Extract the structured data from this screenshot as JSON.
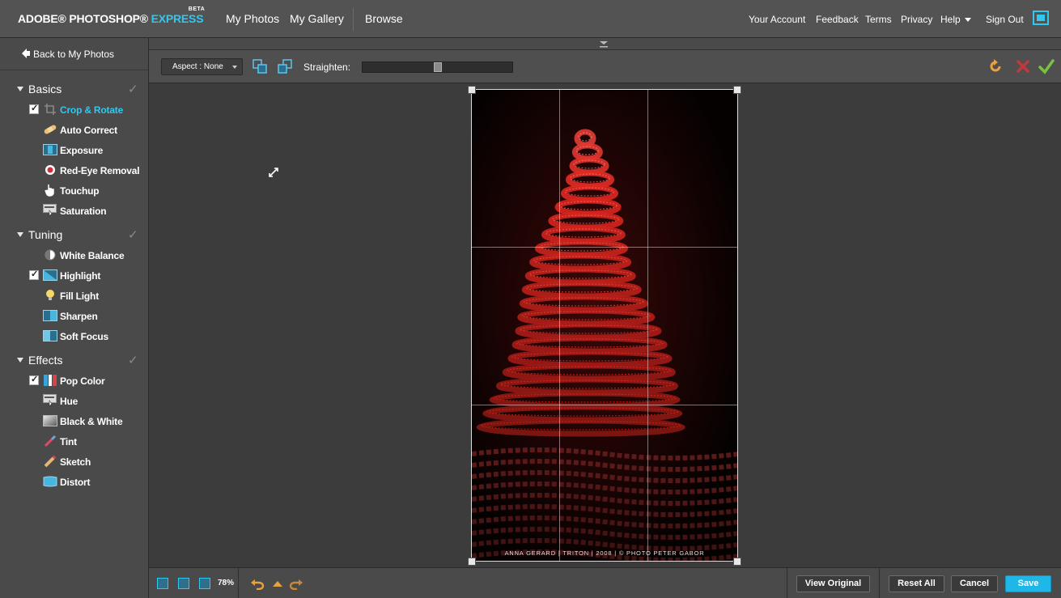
{
  "header": {
    "logo_main": "ADOBE® PHOTOSHOP®",
    "logo_express": "EXPRESS",
    "logo_beta": "BETA",
    "nav": [
      "My Photos",
      "My Gallery",
      "Browse"
    ],
    "right_nav": [
      "Your Account",
      "Feedback",
      "Terms",
      "Privacy",
      "Help",
      "Sign Out"
    ],
    "fullscreen_icon": "fullscreen-icon"
  },
  "sidebar": {
    "back_label": "Back to My Photos",
    "sections": [
      {
        "name": "Basics",
        "items": [
          {
            "label": "Crop & Rotate",
            "checked": true,
            "active": true,
            "icon": "crop-icon"
          },
          {
            "label": "Auto Correct",
            "checked": false,
            "icon": "bandage-icon"
          },
          {
            "label": "Exposure",
            "checked": false,
            "icon": "exposure-icon"
          },
          {
            "label": "Red-Eye Removal",
            "checked": false,
            "icon": "red-eye-icon"
          },
          {
            "label": "Touchup",
            "checked": false,
            "icon": "hand-icon"
          },
          {
            "label": "Saturation",
            "checked": false,
            "icon": "saturation-icon"
          }
        ]
      },
      {
        "name": "Tuning",
        "items": [
          {
            "label": "White Balance",
            "checked": false,
            "icon": "white-balance-icon"
          },
          {
            "label": "Highlight",
            "checked": true,
            "icon": "highlight-icon"
          },
          {
            "label": "Fill Light",
            "checked": false,
            "icon": "lightbulb-icon"
          },
          {
            "label": "Sharpen",
            "checked": false,
            "icon": "sharpen-icon"
          },
          {
            "label": "Soft Focus",
            "checked": false,
            "icon": "soft-focus-icon"
          }
        ]
      },
      {
        "name": "Effects",
        "items": [
          {
            "label": "Pop Color",
            "checked": true,
            "icon": "pop-color-icon"
          },
          {
            "label": "Hue",
            "checked": false,
            "icon": "hue-icon"
          },
          {
            "label": "Black & White",
            "checked": false,
            "icon": "black-white-icon"
          },
          {
            "label": "Tint",
            "checked": false,
            "icon": "tint-icon"
          },
          {
            "label": "Sketch",
            "checked": false,
            "icon": "sketch-icon"
          },
          {
            "label": "Distort",
            "checked": false,
            "icon": "distort-icon"
          }
        ]
      }
    ]
  },
  "toolbar": {
    "aspect_label": "Aspect : None",
    "straighten_label": "Straighten:",
    "straighten_value": 0.5
  },
  "photo": {
    "caption": "ANNA GERARD | TRITON | 2008 | © PHOTO PETER GABOR"
  },
  "bottom": {
    "zoom": "78%",
    "view_original": "View Original",
    "reset_all": "Reset All",
    "cancel": "Cancel",
    "save": "Save"
  },
  "colors": {
    "accent": "#2ec8f0",
    "save_button": "#1fb7e8",
    "cancel_x": "#c0393f",
    "confirm_check": "#7ac143",
    "undo": "#e8a13c"
  }
}
